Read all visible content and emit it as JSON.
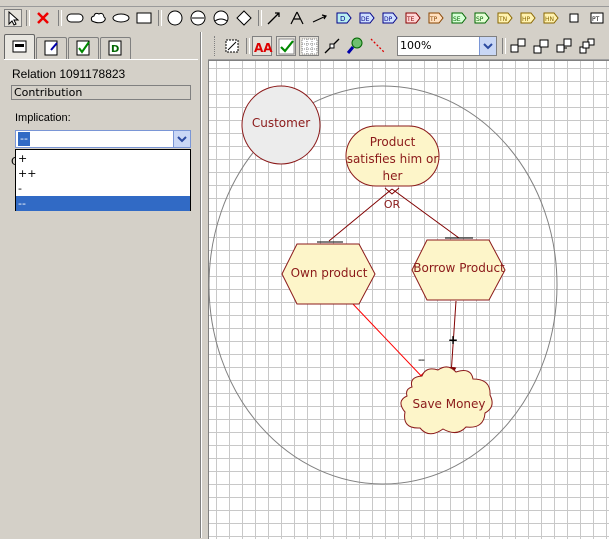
{
  "panel": {
    "relation_label": "Relation 1091178823",
    "relation_type": "Contribution",
    "implication_label": "Implication:",
    "implication_selected": "--",
    "implication_options": [
      "+",
      "++",
      "-",
      "--"
    ]
  },
  "canvas": {
    "zoom": "100%",
    "nodes": {
      "customer": "Customer",
      "product_satisfies": "Product satisfies him or her",
      "own_product": "Own product",
      "borrow_product": "Borrow Product",
      "save_money": "Save Money"
    },
    "labels": {
      "or": "OR",
      "own_impl": "--",
      "borrow_impl": "+"
    }
  },
  "colors": {
    "node_fill": "#fdf5c9",
    "node_stroke": "#8b1a1a",
    "selected_link": "#ff0000",
    "link": "#800000",
    "selection_blue": "#316ac5"
  }
}
